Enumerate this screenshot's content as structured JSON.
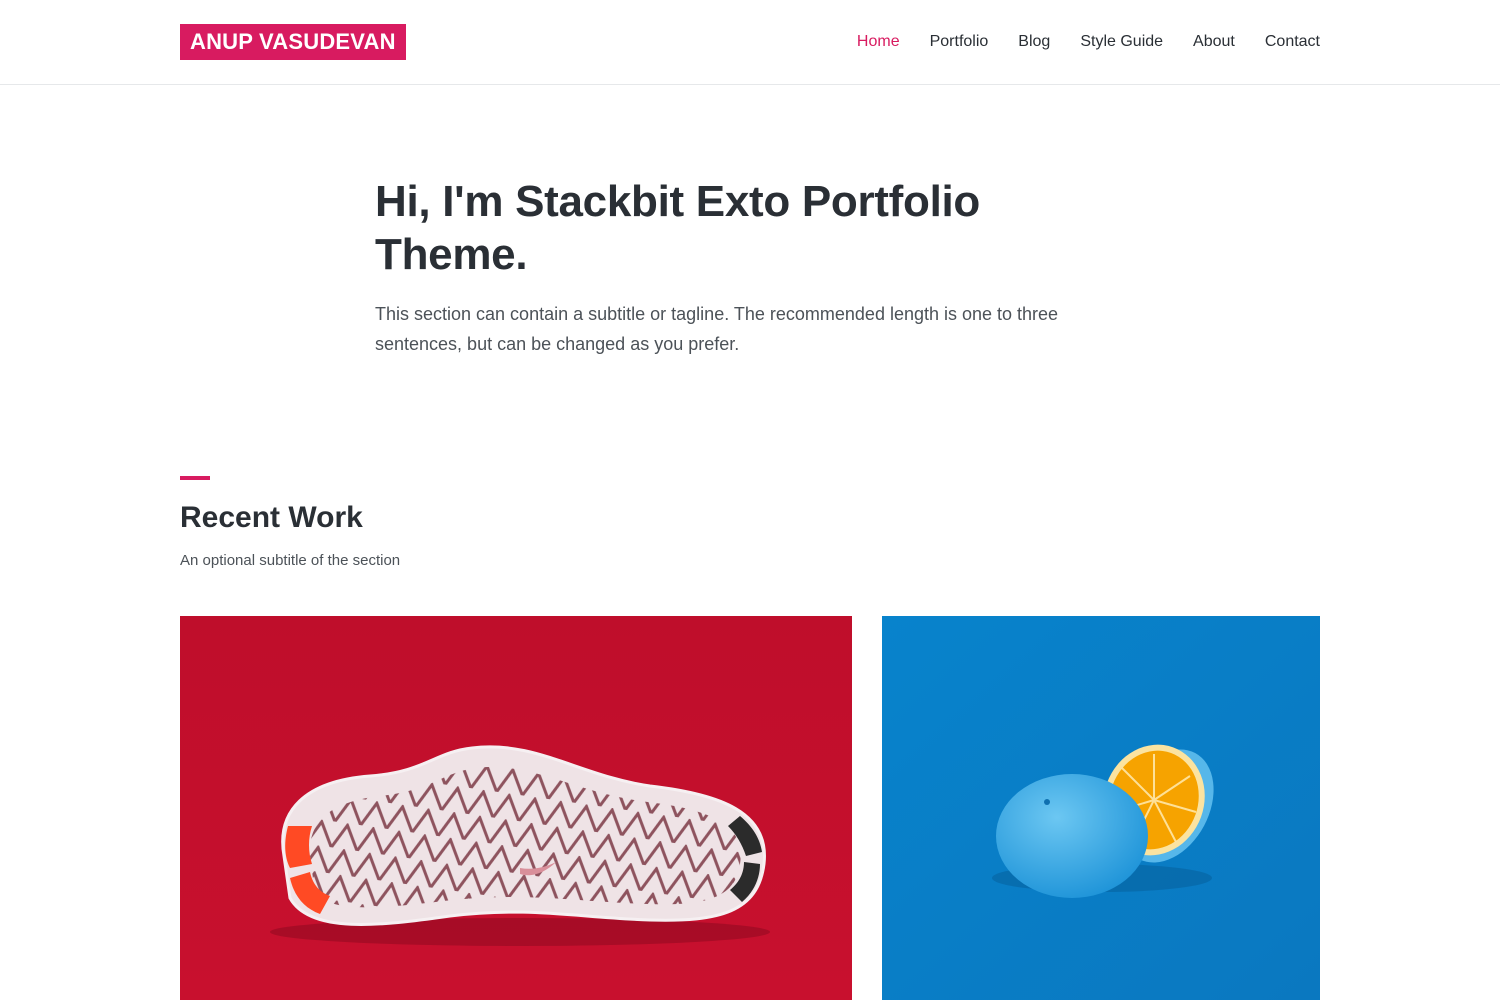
{
  "header": {
    "logo": "ANUP VASUDEVAN",
    "nav": [
      {
        "label": "Home",
        "active": true
      },
      {
        "label": "Portfolio",
        "active": false
      },
      {
        "label": "Blog",
        "active": false
      },
      {
        "label": "Style Guide",
        "active": false
      },
      {
        "label": "About",
        "active": false
      },
      {
        "label": "Contact",
        "active": false
      }
    ]
  },
  "hero": {
    "title": "Hi, I'm Stackbit Exto Portfolio Theme.",
    "subtitle": "This section can contain a subtitle or tagline. The recommended length is one to three sentences, but can be changed as you prefer."
  },
  "recent_work": {
    "title": "Recent Work",
    "subtitle": "An optional subtitle of the section",
    "items": [
      {
        "image": "white-sneaker-sole-on-red-background",
        "bg_color": "#c0102b"
      },
      {
        "image": "blue-painted-orange-on-blue-background",
        "bg_color": "#0a7fc7"
      }
    ]
  },
  "colors": {
    "accent": "#d81b60",
    "text": "#2a2f35",
    "muted": "#4c5258"
  }
}
